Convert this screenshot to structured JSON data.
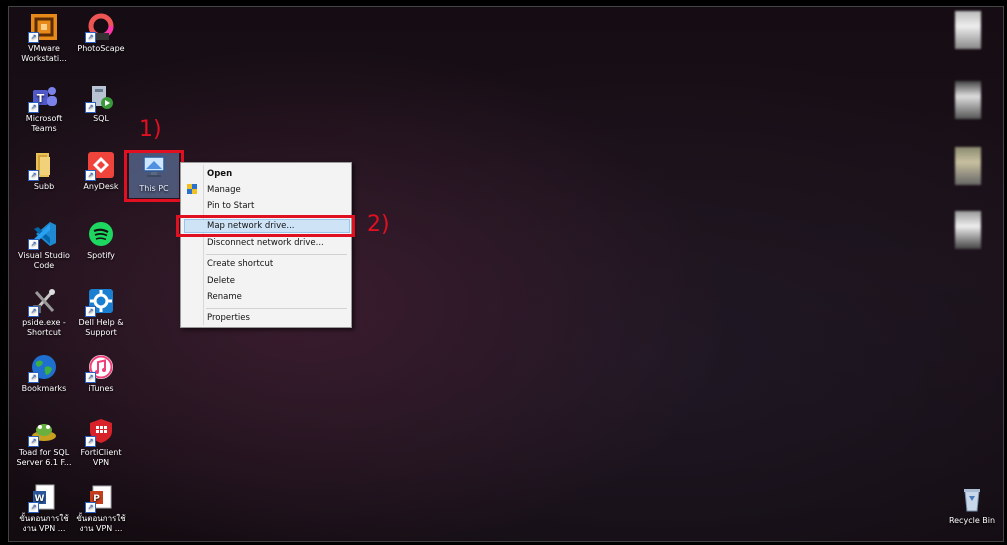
{
  "desktop_icons": [
    {
      "label": "VMware Workstati...",
      "icon": "vmware-icon"
    },
    {
      "label": "PhotoScape",
      "icon": "photoscape-icon"
    },
    {
      "label": "Microsoft Teams",
      "icon": "teams-icon"
    },
    {
      "label": "SQL",
      "icon": "sql-icon"
    },
    {
      "label": "Subb",
      "icon": "folder-icon"
    },
    {
      "label": "AnyDesk",
      "icon": "anydesk-icon"
    },
    {
      "label": "This PC",
      "icon": "computer-icon"
    },
    {
      "label": "Visual Studio Code",
      "icon": "vscode-icon"
    },
    {
      "label": "Spotify",
      "icon": "spotify-icon"
    },
    {
      "label": "pside.exe - Shortcut",
      "icon": "pside-icon"
    },
    {
      "label": "Dell Help & Support",
      "icon": "dell-help-icon"
    },
    {
      "label": "Bookmarks",
      "icon": "bookmarks-globe-icon"
    },
    {
      "label": "iTunes",
      "icon": "itunes-icon"
    },
    {
      "label": "Toad for SQL Server 6.1 F...",
      "icon": "toad-icon"
    },
    {
      "label": "FortiClient VPN",
      "icon": "forticlient-icon"
    },
    {
      "label": "ขั้นตอนการใช้งาน VPN ...",
      "icon": "word-doc-icon"
    },
    {
      "label": "ขั้นตอนการใช้งาน VPN ...",
      "icon": "powerpoint-doc-icon"
    },
    {
      "label": "Recycle Bin",
      "icon": "recycle-bin-icon"
    }
  ],
  "context_menu": {
    "items": [
      {
        "label": "Open",
        "bold": true
      },
      {
        "label": "Manage"
      },
      {
        "label": "Pin to Start"
      },
      {
        "label": "Map network drive..."
      },
      {
        "label": "Disconnect network drive..."
      },
      {
        "label": "Create shortcut"
      },
      {
        "label": "Delete"
      },
      {
        "label": "Rename"
      },
      {
        "label": "Properties"
      }
    ]
  },
  "annotations": {
    "step1": "1)",
    "step2": "2)",
    "color": "#e01020"
  }
}
